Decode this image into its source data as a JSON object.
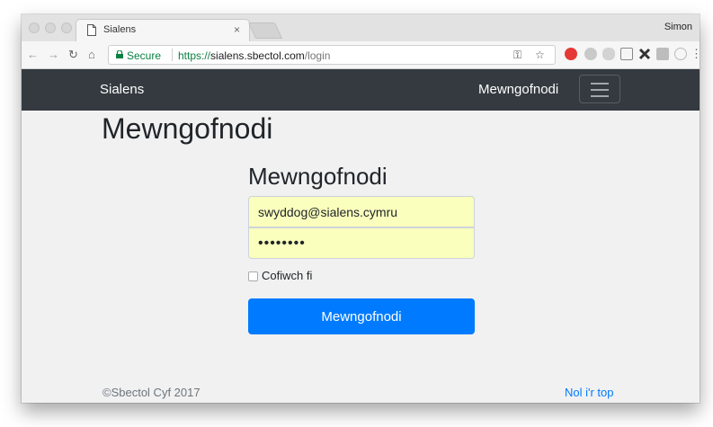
{
  "browser": {
    "tab_title": "Sialens",
    "tab_close": "×",
    "profile_name": "Simon",
    "secure_label": "Secure",
    "url_scheme": "https://",
    "url_host": "sialens.sbectol.com",
    "url_path": "/login",
    "nav_icons": [
      "back-arrow-icon",
      "forward-arrow-icon",
      "reload-icon",
      "home-icon"
    ],
    "extension_icons": [
      "key-icon",
      "star-icon",
      "adblock-icon",
      "wordpress-icon",
      "cloud-icon",
      "cast-icon",
      "tools-icon",
      "square-icon",
      "circle-icon",
      "menu-dots-icon"
    ]
  },
  "navbar": {
    "brand": "Sialens",
    "login_link": "Mewngofnodi"
  },
  "page": {
    "heading": "Mewngofnodi"
  },
  "form": {
    "heading": "Mewngofnodi",
    "email_value": "swyddog@sialens.cymru",
    "password_value": "••••••••",
    "remember_label": "Cofiwch fi",
    "submit_label": "Mewngofnodi"
  },
  "footer": {
    "copyright": "©Sbectol Cyf 2017",
    "back_to_top": "Nol i'r top"
  },
  "colors": {
    "navbar_bg": "#343a40",
    "primary": "#007bff",
    "autofill": "#faffbd",
    "secure_green": "#0b8043"
  }
}
